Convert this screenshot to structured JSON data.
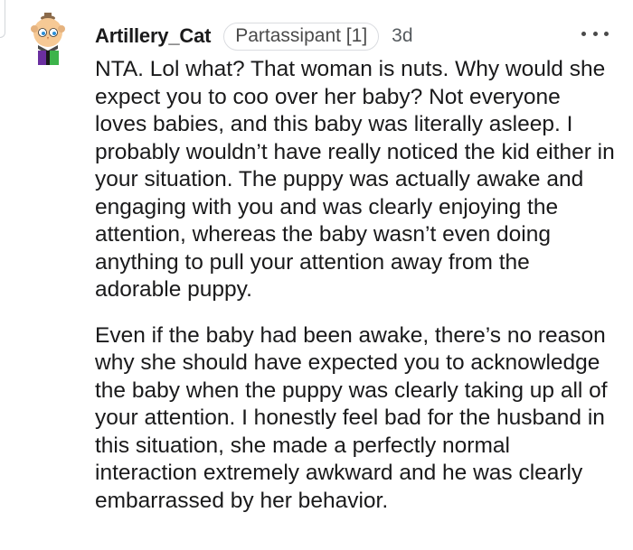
{
  "comment": {
    "username": "Artillery_Cat",
    "flair": "Partassipant [1]",
    "age": "3d",
    "avatar_icon": "cartoon-avatar-icon",
    "more_icon": "more-options-icon",
    "paragraphs": [
      "NTA. Lol what? That woman is nuts. Why would she expect you to coo over her baby? Not everyone loves babies, and this baby was literally asleep. I probably wouldn’t have really noticed the kid either in your situation. The puppy was actually awake and engaging with you and was clearly enjoying the attention, whereas the baby wasn’t even doing anything to pull your attention away from the adorable puppy.",
      "Even if the baby had been awake, there’s no reason why she should have expected you to acknowledge the baby when the puppy was clearly taking up all of your attention. I honestly feel bad for the husband in this situation, she made a perfectly normal interaction extremely awkward and he was clearly embarrassed by her behavior."
    ]
  },
  "colors": {
    "text": "#1a1a1b",
    "meta": "#555a5e",
    "flair_border": "#dadce0",
    "avatar_skin": "#f6c995",
    "avatar_shirt_purple": "#6a2fa0",
    "avatar_shirt_green": "#3cb34a"
  }
}
